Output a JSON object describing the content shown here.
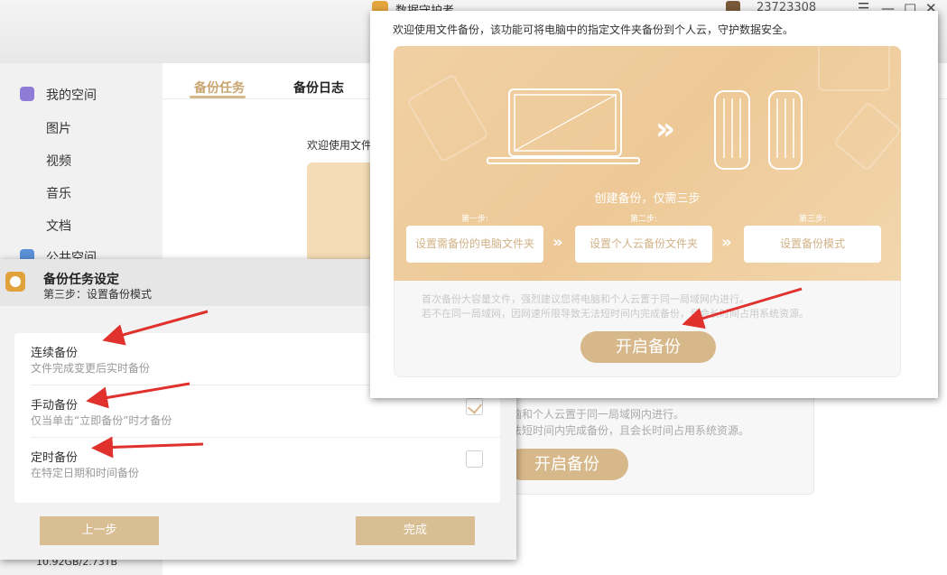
{
  "app": {
    "title": "数据守护者",
    "user_id": "23723308",
    "sidebar": {
      "my_space": "我的空间",
      "items": [
        "图片",
        "视频",
        "音乐",
        "文档"
      ],
      "public_space": "公共空间",
      "storage": "10.92GB/2.73TB"
    },
    "tabs": [
      "备份任务",
      "备份日志"
    ],
    "welcome_partial": "欢迎使用文件",
    "notes_partial": [
      "脑和个人云置于同一局域网内进行。",
      "法短时间内完成备份，且会长时间占用系统资源。"
    ],
    "start_label": "开启备份"
  },
  "dialog": {
    "title": "备份任务设定",
    "step": "第三步：设置备份模式",
    "options": [
      {
        "title": "连续备份",
        "desc": "文件完成变更后实时备份",
        "checked": false
      },
      {
        "title": "手动备份",
        "desc": "仅当单击“立即备份”时才备份",
        "checked": true
      },
      {
        "title": "定时备份",
        "desc": "在特定日期和时间备份",
        "checked": false
      }
    ],
    "prev_label": "上一步",
    "finish_label": "完成"
  },
  "popup": {
    "intro": "欢迎使用文件备份，该功能可将电脑中的指定文件夹备份到个人云，守护数据安全。",
    "headline": "创建备份，仅需三步",
    "steps": [
      {
        "label": "第一步:",
        "text": "设置需备份的电脑文件夹"
      },
      {
        "label": "第二步:",
        "text": "设置个人云备份文件夹"
      },
      {
        "label": "第三步:",
        "text": "设置备份模式"
      }
    ],
    "notes": [
      "首次备份大容量文件，强烈建议您将电脑和个人云置于同一局域网内进行。",
      "若不在同一局域网，因网速所限导致无法短时间内完成备份，且会长时间占用系统资源。"
    ],
    "start_label": "开启备份"
  },
  "colors": {
    "accent": "#d7b88a",
    "hero": "#eec997",
    "arrow": "#e0312d"
  }
}
